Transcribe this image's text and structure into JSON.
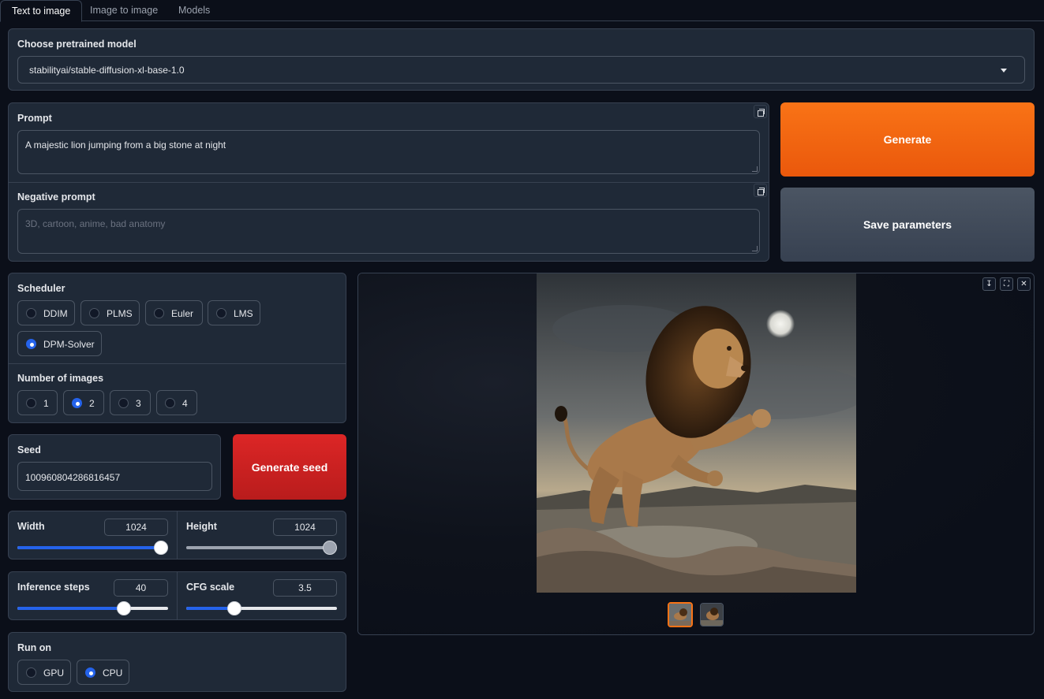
{
  "tabs": [
    {
      "label": "Text to image",
      "active": true
    },
    {
      "label": "Image to image",
      "active": false
    },
    {
      "label": "Models",
      "active": false
    }
  ],
  "model": {
    "label": "Choose pretrained model",
    "value": "stabilityai/stable-diffusion-xl-base-1.0"
  },
  "prompt": {
    "label": "Prompt",
    "value": "A majestic lion jumping from a big stone at night"
  },
  "negative_prompt": {
    "label": "Negative prompt",
    "placeholder": "3D, cartoon, anime, bad anatomy"
  },
  "buttons": {
    "generate": "Generate",
    "save_parameters": "Save parameters",
    "generate_seed": "Generate seed"
  },
  "scheduler": {
    "label": "Scheduler",
    "options": [
      "DDIM",
      "PLMS",
      "Euler",
      "LMS",
      "DPM-Solver"
    ],
    "selected": "DPM-Solver"
  },
  "num_images": {
    "label": "Number of images",
    "options": [
      "1",
      "2",
      "3",
      "4"
    ],
    "selected": "2"
  },
  "seed": {
    "label": "Seed",
    "value": "100960804286816457"
  },
  "width": {
    "label": "Width",
    "value": "1024",
    "level": 1.0
  },
  "height": {
    "label": "Height",
    "value": "1024",
    "level": 1.0
  },
  "inference_steps": {
    "label": "Inference steps",
    "value": "40",
    "level": 0.73
  },
  "cfg_scale": {
    "label": "CFG scale",
    "value": "3.5",
    "level": 0.3
  },
  "run_on": {
    "label": "Run on",
    "options": [
      "GPU",
      "CPU"
    ],
    "selected": "CPU"
  },
  "gallery": {
    "image_count": 2,
    "selected_index": 0,
    "icons": [
      "download-icon",
      "fullscreen-icon",
      "close-icon"
    ]
  },
  "colors": {
    "accent_orange": "#f97316",
    "accent_red": "#dc2626",
    "accent_blue": "#2563eb",
    "panel": "#1f2937",
    "background": "#0b0f19"
  }
}
